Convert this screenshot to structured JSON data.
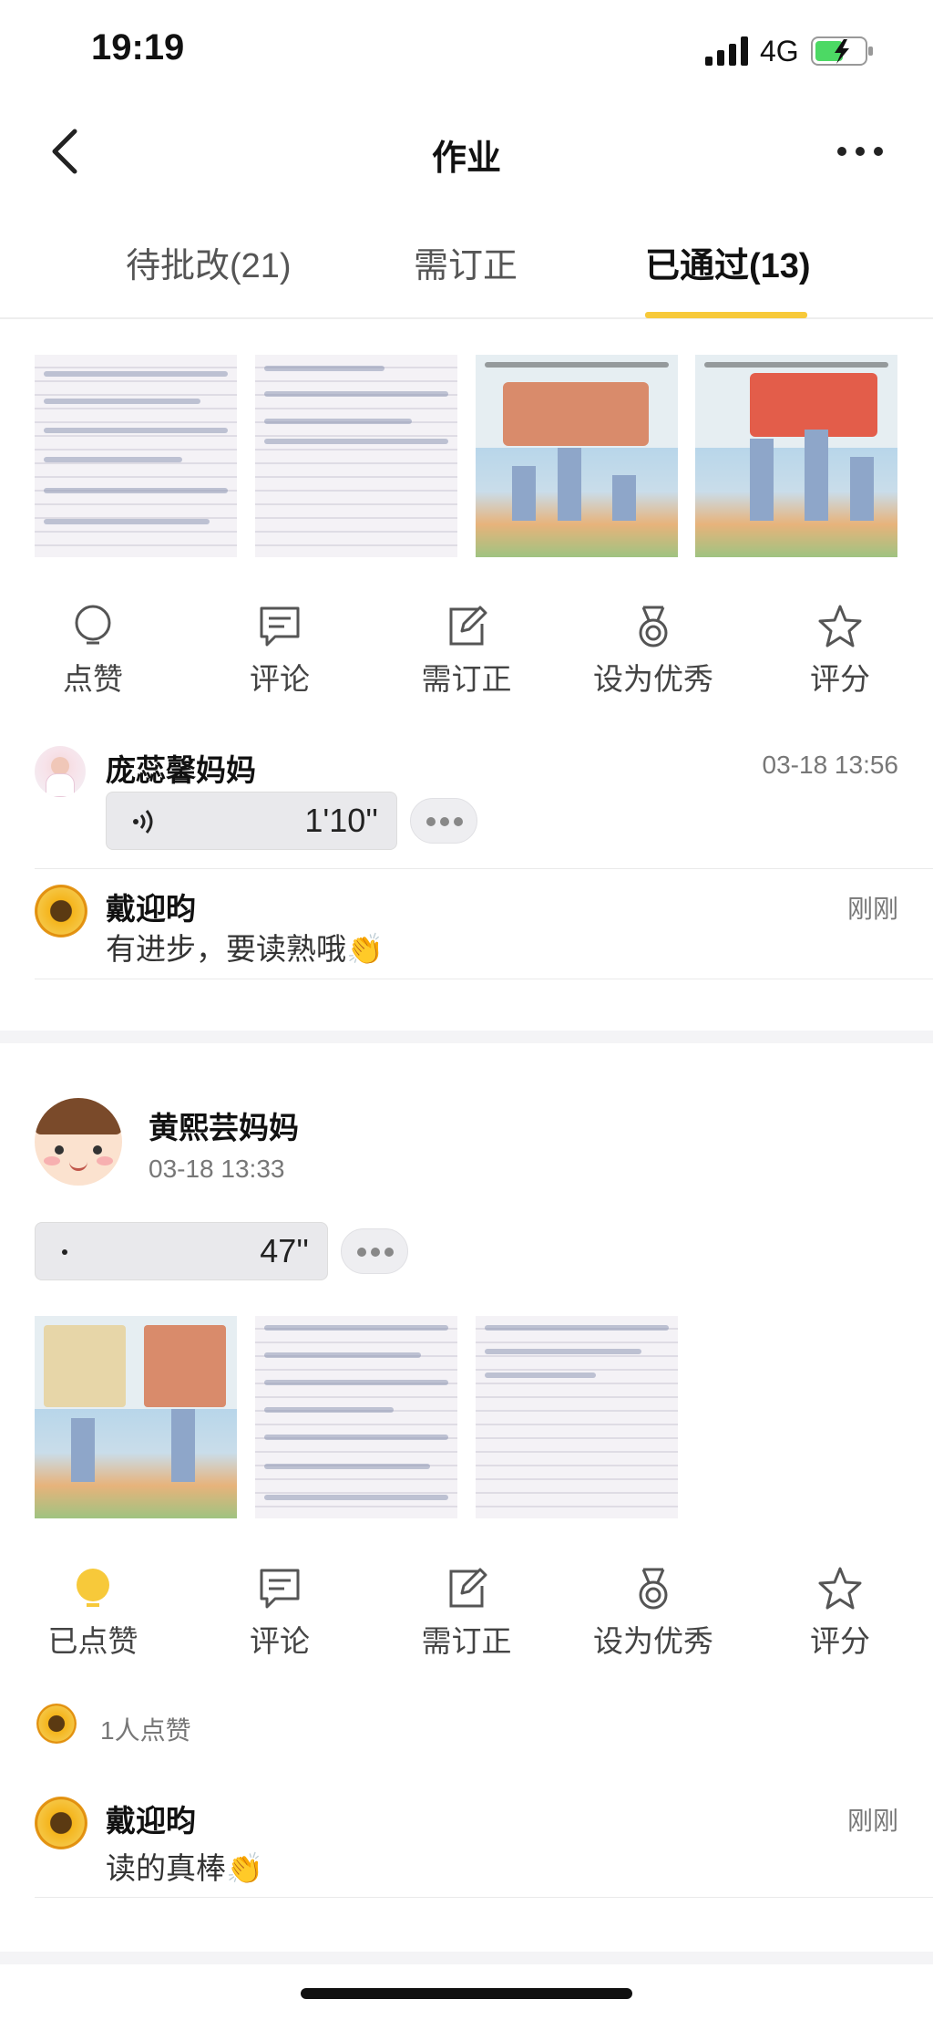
{
  "status": {
    "time": "19:19",
    "network": "4G"
  },
  "nav": {
    "title": "作业"
  },
  "tabs": [
    {
      "label": "待批改(21)"
    },
    {
      "label": "需订正"
    },
    {
      "label": "已通过(13)",
      "active": true
    }
  ],
  "actions": {
    "like": "点赞",
    "liked": "已点赞",
    "comment": "评论",
    "correct": "需订正",
    "excellent": "设为优秀",
    "score": "评分"
  },
  "post1": {
    "voice_reply": {
      "author": "庞蕊馨妈妈",
      "time": "03-18 13:56",
      "duration": "1'10''"
    },
    "comment": {
      "author": "戴迎昀",
      "time": "刚刚",
      "text": "有进步，要读熟哦👏"
    }
  },
  "post2": {
    "author": "黄熙芸妈妈",
    "time": "03-18 13:33",
    "duration": "47''",
    "likes_text": "1人点赞",
    "comment": {
      "author": "戴迎昀",
      "time": "刚刚",
      "text": "读的真棒👏"
    }
  },
  "colors": {
    "accent": "#f7c93a",
    "like_active": "#f7c93a"
  }
}
